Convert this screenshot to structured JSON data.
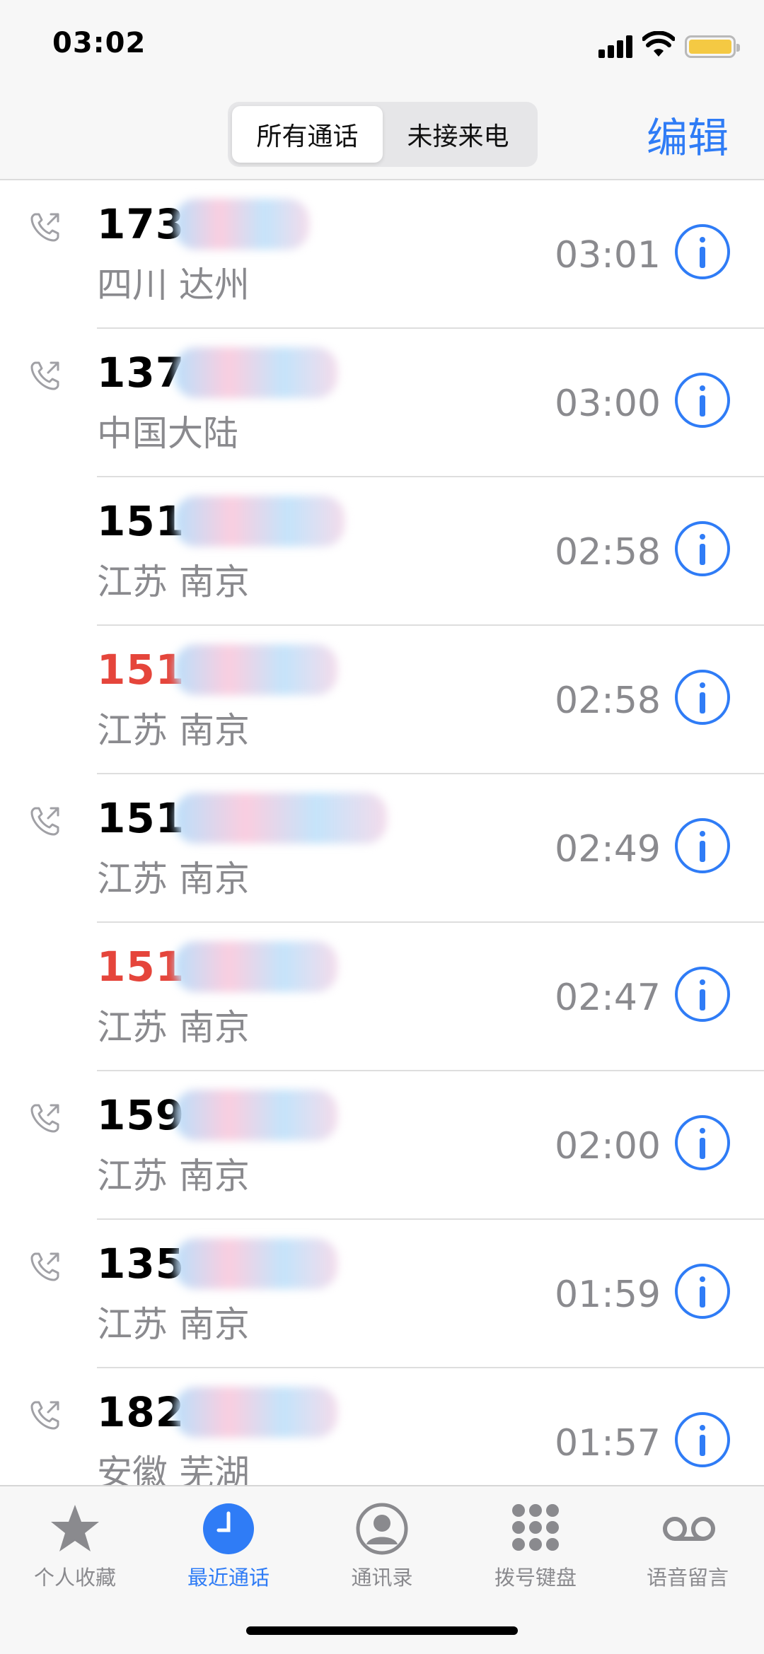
{
  "status_bar": {
    "time": "03:02"
  },
  "nav": {
    "segments": [
      "所有通话",
      "未接来电"
    ],
    "edit_label": "编辑"
  },
  "colors": {
    "accent": "#2f7cf6",
    "missed": "#e5453b",
    "secondary_text": "#8a8a8e",
    "battery": "#f4c943"
  },
  "calls": [
    {
      "number": "173",
      "location": "四川 达州",
      "time": "03:01",
      "missed": false,
      "outgoing": true
    },
    {
      "number": "137",
      "location": "中国大陆",
      "time": "03:00",
      "missed": false,
      "outgoing": true
    },
    {
      "number": "151",
      "location": "江苏 南京",
      "time": "02:58",
      "missed": false,
      "outgoing": false
    },
    {
      "number": "151",
      "location": "江苏 南京",
      "time": "02:58",
      "missed": true,
      "outgoing": false
    },
    {
      "number": "151",
      "location": "江苏 南京",
      "time": "02:49",
      "missed": false,
      "outgoing": true
    },
    {
      "number": "151",
      "location": "江苏 南京",
      "time": "02:47",
      "missed": true,
      "outgoing": false
    },
    {
      "number": "159",
      "location": "江苏 南京",
      "time": "02:00",
      "missed": false,
      "outgoing": true
    },
    {
      "number": "135",
      "location": "江苏 南京",
      "time": "01:59",
      "missed": false,
      "outgoing": true
    },
    {
      "number": "182",
      "location": "安徽 芜湖",
      "time": "01:57",
      "missed": false,
      "outgoing": true
    }
  ],
  "tabs": [
    {
      "label": "个人收藏",
      "icon": "star-icon",
      "active": false
    },
    {
      "label": "最近通话",
      "icon": "clock-icon",
      "active": true
    },
    {
      "label": "通讯录",
      "icon": "contacts-icon",
      "active": false
    },
    {
      "label": "拨号键盘",
      "icon": "keypad-icon",
      "active": false
    },
    {
      "label": "语音留言",
      "icon": "voicemail-icon",
      "active": false
    }
  ]
}
